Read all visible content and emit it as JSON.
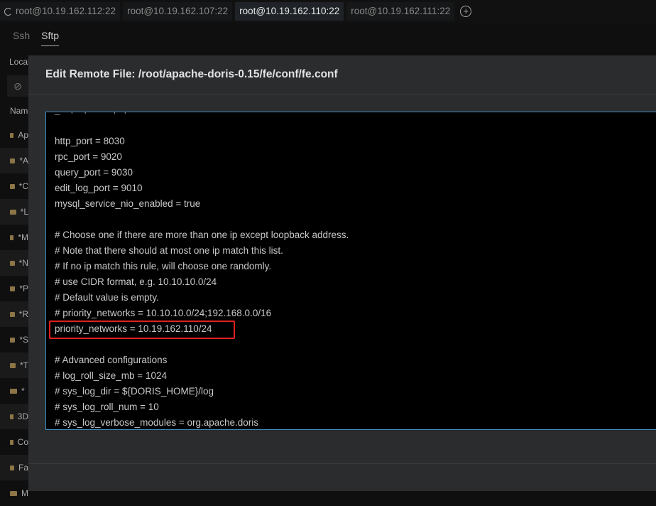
{
  "tabs": [
    {
      "label": "root@10.19.162.112:22",
      "loading": true
    },
    {
      "label": "root@10.19.162.107:22"
    },
    {
      "label": "root@10.19.162.110:22",
      "active": true
    },
    {
      "label": "root@10.19.162.111:22"
    }
  ],
  "subtabs": [
    "Ssh",
    "Sftp"
  ],
  "local_label": "Local",
  "name_header": "Nam",
  "sidebar_items": [
    "Ap",
    "*A",
    "*C",
    "*L",
    "*M",
    "*N",
    "*P",
    "*R",
    "*S",
    "*T",
    "*",
    "3D",
    "Co",
    "Fa",
    "M"
  ],
  "dialog": {
    "title": "Edit Remote File: /root/apache-doris-0.15/fe/conf/fe.conf",
    "lines": [
      "",
      "http_port = 8030",
      "rpc_port = 9020",
      "query_port = 9030",
      "edit_log_port = 9010",
      "mysql_service_nio_enabled = true",
      "",
      "# Choose one if there are more than one ip except loopback address.",
      "# Note that there should at most one ip match this list.",
      "# If no ip match this rule, will choose one randomly.",
      "# use CIDR format, e.g. 10.10.10.0/24",
      "# Default value is empty.",
      "# priority_networks = 10.10.10.0/24;192.168.0.0/16",
      "priority_networks = 10.19.162.110/24",
      "",
      "# Advanced configurations",
      "# log_roll_size_mb = 1024",
      "# sys_log_dir = ${DORIS_HOME}/log",
      "# sys_log_roll_num = 10",
      "# sys_log_verbose_modules = org.apache.doris"
    ],
    "highlight_color": "#e0201e",
    "border_color": "#3d8fc8"
  }
}
